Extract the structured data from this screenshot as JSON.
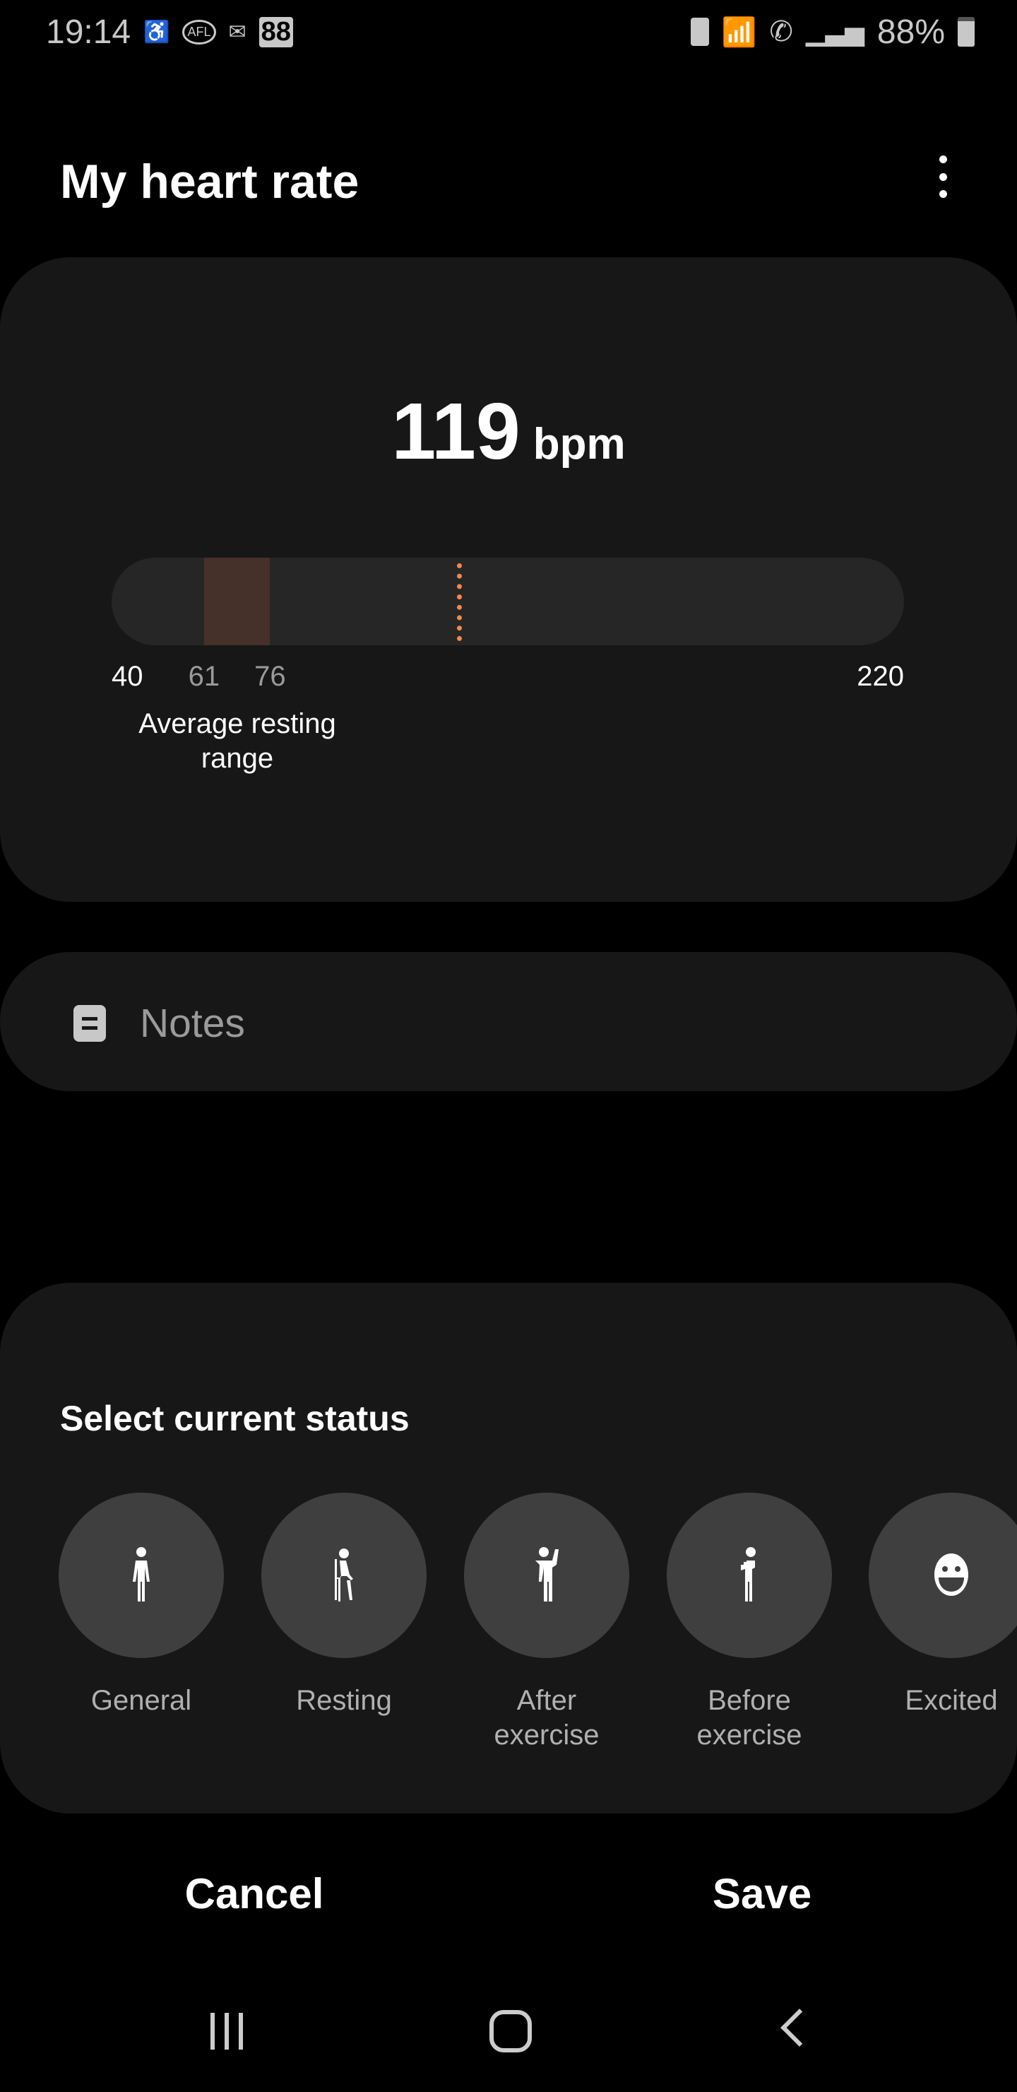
{
  "status_bar": {
    "time": "19:14",
    "battery": "88%",
    "icons_left": [
      "accessibility-icon",
      "afl-icon",
      "outlook-icon",
      "calendar-88-icon"
    ],
    "icons_right": [
      "battery-saver-icon",
      "wifi-icon",
      "wifi-calling-icon",
      "signal-icon",
      "battery-icon"
    ]
  },
  "header": {
    "title": "My heart rate",
    "more_icon": "more-vertical-icon"
  },
  "reading": {
    "value": "119",
    "unit": "bpm",
    "min": "40",
    "max": "220",
    "resting_low": "61",
    "resting_high": "76",
    "range_label_1": "Average resting",
    "range_label_2": "range",
    "value_number": 119,
    "min_number": 40,
    "max_number": 220,
    "resting_low_number": 61,
    "resting_high_number": 76
  },
  "colors": {
    "marker": "#f08a4b",
    "resting_band": "#45302a",
    "card": "#171717"
  },
  "notes": {
    "placeholder": "Notes",
    "icon": "note-icon"
  },
  "status": {
    "title": "Select current status",
    "options": [
      {
        "label1": "General",
        "label2": "",
        "icon": "standing-person-icon"
      },
      {
        "label1": "Resting",
        "label2": "",
        "icon": "sitting-person-icon"
      },
      {
        "label1": "After",
        "label2": "exercise",
        "icon": "flexing-person-icon"
      },
      {
        "label1": "Before",
        "label2": "exercise",
        "icon": "stretching-person-icon"
      },
      {
        "label1": "Excited",
        "label2": "",
        "icon": "smiley-icon"
      }
    ]
  },
  "actions": {
    "cancel": "Cancel",
    "save": "Save"
  },
  "nav": {
    "recents": "recents-icon",
    "home": "home-icon",
    "back": "back-icon"
  }
}
